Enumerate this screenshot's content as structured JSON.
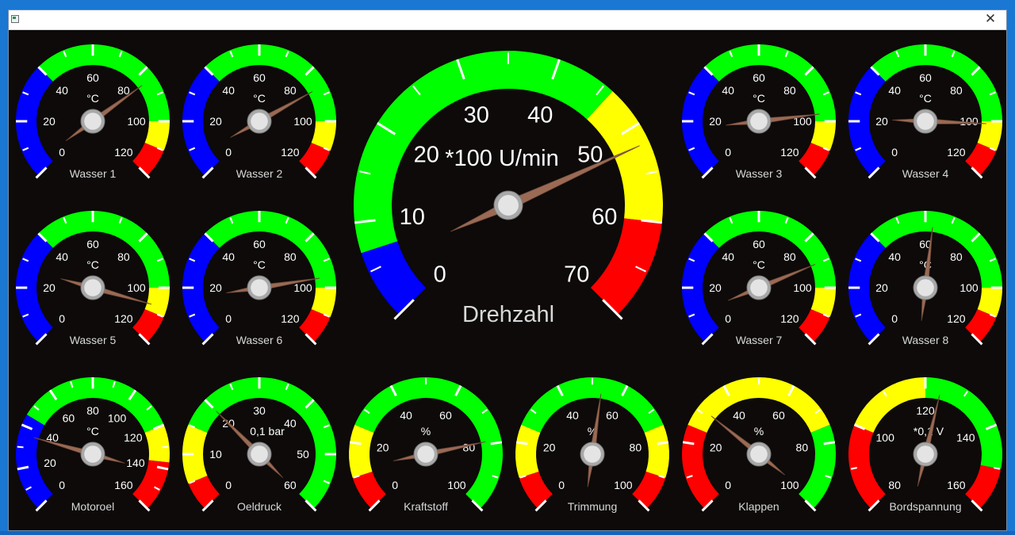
{
  "window": {
    "title": "",
    "close_glyph": "✕",
    "app_icon": "window-app-icon",
    "background": "#0d0a09"
  },
  "colors": {
    "blue": "#0000ff",
    "green": "#00ff00",
    "yellow": "#ffff00",
    "red": "#ff0000",
    "needle": "#9a6a55",
    "text": "#ffffff",
    "label": "#d8d8d8"
  },
  "gauges": [
    {
      "id": "wasser-1",
      "label": "Wasser 1",
      "unit": "°C",
      "ticks": [
        "0",
        "20",
        "40",
        "60",
        "80",
        "100",
        "120"
      ],
      "min": 0,
      "max": 120,
      "value": 84,
      "zones": [
        {
          "from": 0,
          "to": 40,
          "color": "blue"
        },
        {
          "from": 40,
          "to": 100,
          "color": "green"
        },
        {
          "from": 100,
          "to": 110,
          "color": "yellow"
        },
        {
          "from": 110,
          "to": 120,
          "color": "red"
        }
      ]
    },
    {
      "id": "wasser-2",
      "label": "Wasser 2",
      "unit": "°C",
      "ticks": [
        "0",
        "20",
        "40",
        "60",
        "80",
        "100",
        "120"
      ],
      "min": 0,
      "max": 120,
      "value": 87,
      "zones": [
        {
          "from": 0,
          "to": 40,
          "color": "blue"
        },
        {
          "from": 40,
          "to": 100,
          "color": "green"
        },
        {
          "from": 100,
          "to": 110,
          "color": "yellow"
        },
        {
          "from": 110,
          "to": 120,
          "color": "red"
        }
      ]
    },
    {
      "id": "wasser-3",
      "label": "Wasser 3",
      "unit": "°C",
      "ticks": [
        "0",
        "20",
        "40",
        "60",
        "80",
        "100",
        "120"
      ],
      "min": 0,
      "max": 120,
      "value": 97,
      "zones": [
        {
          "from": 0,
          "to": 40,
          "color": "blue"
        },
        {
          "from": 40,
          "to": 100,
          "color": "green"
        },
        {
          "from": 100,
          "to": 110,
          "color": "yellow"
        },
        {
          "from": 110,
          "to": 120,
          "color": "red"
        }
      ]
    },
    {
      "id": "wasser-4",
      "label": "Wasser 4",
      "unit": "°C",
      "ticks": [
        "0",
        "20",
        "40",
        "60",
        "80",
        "100",
        "120"
      ],
      "min": 0,
      "max": 120,
      "value": 101,
      "zones": [
        {
          "from": 0,
          "to": 40,
          "color": "blue"
        },
        {
          "from": 40,
          "to": 100,
          "color": "green"
        },
        {
          "from": 100,
          "to": 110,
          "color": "yellow"
        },
        {
          "from": 110,
          "to": 120,
          "color": "red"
        }
      ]
    },
    {
      "id": "wasser-5",
      "label": "Wasser 5",
      "unit": "°C",
      "ticks": [
        "0",
        "20",
        "40",
        "60",
        "80",
        "100",
        "120"
      ],
      "min": 0,
      "max": 120,
      "value": 107,
      "zones": [
        {
          "from": 0,
          "to": 40,
          "color": "blue"
        },
        {
          "from": 40,
          "to": 100,
          "color": "green"
        },
        {
          "from": 100,
          "to": 110,
          "color": "yellow"
        },
        {
          "from": 110,
          "to": 120,
          "color": "red"
        }
      ]
    },
    {
      "id": "wasser-6",
      "label": "Wasser 6",
      "unit": "°C",
      "ticks": [
        "0",
        "20",
        "40",
        "60",
        "80",
        "100",
        "120"
      ],
      "min": 0,
      "max": 120,
      "value": 96,
      "zones": [
        {
          "from": 0,
          "to": 40,
          "color": "blue"
        },
        {
          "from": 40,
          "to": 100,
          "color": "green"
        },
        {
          "from": 100,
          "to": 110,
          "color": "yellow"
        },
        {
          "from": 110,
          "to": 120,
          "color": "red"
        }
      ]
    },
    {
      "id": "wasser-7",
      "label": "Wasser 7",
      "unit": "°C",
      "ticks": [
        "0",
        "20",
        "40",
        "60",
        "80",
        "100",
        "120"
      ],
      "min": 0,
      "max": 120,
      "value": 90,
      "zones": [
        {
          "from": 0,
          "to": 40,
          "color": "blue"
        },
        {
          "from": 40,
          "to": 100,
          "color": "green"
        },
        {
          "from": 100,
          "to": 110,
          "color": "yellow"
        },
        {
          "from": 110,
          "to": 120,
          "color": "red"
        }
      ]
    },
    {
      "id": "wasser-8",
      "label": "Wasser 8",
      "unit": "°C",
      "ticks": [
        "0",
        "20",
        "40",
        "60",
        "80",
        "100",
        "120"
      ],
      "min": 0,
      "max": 120,
      "value": 63,
      "zones": [
        {
          "from": 0,
          "to": 40,
          "color": "blue"
        },
        {
          "from": 40,
          "to": 100,
          "color": "green"
        },
        {
          "from": 100,
          "to": 110,
          "color": "yellow"
        },
        {
          "from": 110,
          "to": 120,
          "color": "red"
        }
      ]
    },
    {
      "id": "motoroel",
      "label": "Motoroel",
      "unit": "°C",
      "ticks": [
        "0",
        "20",
        "40",
        "60",
        "80",
        "100",
        "120",
        "140",
        "160"
      ],
      "min": 0,
      "max": 160,
      "value": 36,
      "zones": [
        {
          "from": 0,
          "to": 45,
          "color": "blue"
        },
        {
          "from": 45,
          "to": 120,
          "color": "green"
        },
        {
          "from": 120,
          "to": 137,
          "color": "yellow"
        },
        {
          "from": 137,
          "to": 160,
          "color": "red"
        }
      ]
    },
    {
      "id": "oeldruck",
      "label": "Oeldruck",
      "unit": "0,1 bar",
      "ticks": [
        "0",
        "10",
        "20",
        "30",
        "40",
        "50",
        "60"
      ],
      "min": 0,
      "max": 60,
      "value": 20,
      "zones": [
        {
          "from": 0,
          "to": 5,
          "color": "red"
        },
        {
          "from": 5,
          "to": 15,
          "color": "yellow"
        },
        {
          "from": 15,
          "to": 60,
          "color": "green"
        }
      ]
    },
    {
      "id": "kraftstoff",
      "label": "Kraftstoff",
      "unit": "%",
      "ticks": [
        "0",
        "20",
        "40",
        "60",
        "80",
        "100"
      ],
      "min": 0,
      "max": 100,
      "value": 79,
      "zones": [
        {
          "from": 0,
          "to": 10,
          "color": "red"
        },
        {
          "from": 10,
          "to": 25,
          "color": "yellow"
        },
        {
          "from": 25,
          "to": 100,
          "color": "green"
        }
      ]
    },
    {
      "id": "trimmung",
      "label": "Trimmung",
      "unit": "%",
      "ticks": [
        "0",
        "20",
        "40",
        "60",
        "80",
        "100"
      ],
      "min": 0,
      "max": 100,
      "value": 53,
      "zones": [
        {
          "from": 0,
          "to": 10,
          "color": "red"
        },
        {
          "from": 10,
          "to": 25,
          "color": "yellow"
        },
        {
          "from": 25,
          "to": 75,
          "color": "green"
        },
        {
          "from": 75,
          "to": 90,
          "color": "yellow"
        },
        {
          "from": 90,
          "to": 100,
          "color": "red"
        }
      ]
    },
    {
      "id": "klappen",
      "label": "Klappen",
      "unit": "%",
      "ticks": [
        "0",
        "20",
        "40",
        "60",
        "80",
        "100"
      ],
      "min": 0,
      "max": 100,
      "value": 31,
      "zones": [
        {
          "from": 0,
          "to": 25,
          "color": "red"
        },
        {
          "from": 25,
          "to": 75,
          "color": "yellow"
        },
        {
          "from": 75,
          "to": 100,
          "color": "green"
        }
      ]
    },
    {
      "id": "bordspannung",
      "label": "Bordspannung",
      "unit": "*0,1 V",
      "ticks": [
        "80",
        "100",
        "120",
        "140",
        "160"
      ],
      "min": 80,
      "max": 160,
      "value": 124,
      "zones": [
        {
          "from": 80,
          "to": 100,
          "color": "red"
        },
        {
          "from": 100,
          "to": 120,
          "color": "yellow"
        },
        {
          "from": 120,
          "to": 150,
          "color": "green"
        },
        {
          "from": 150,
          "to": 160,
          "color": "red"
        }
      ]
    }
  ],
  "tachometer": {
    "id": "drehzahl",
    "label": "Drehzahl",
    "unit": "*100 U/min",
    "ticks": [
      "0",
      "10",
      "20",
      "30",
      "40",
      "50",
      "60",
      "70"
    ],
    "min": 0,
    "max": 70,
    "value": 52,
    "zones": [
      {
        "from": 0,
        "to": 7,
        "color": "blue"
      },
      {
        "from": 7,
        "to": 46,
        "color": "green"
      },
      {
        "from": 46,
        "to": 60,
        "color": "yellow"
      },
      {
        "from": 60,
        "to": 70,
        "color": "red"
      }
    ]
  }
}
